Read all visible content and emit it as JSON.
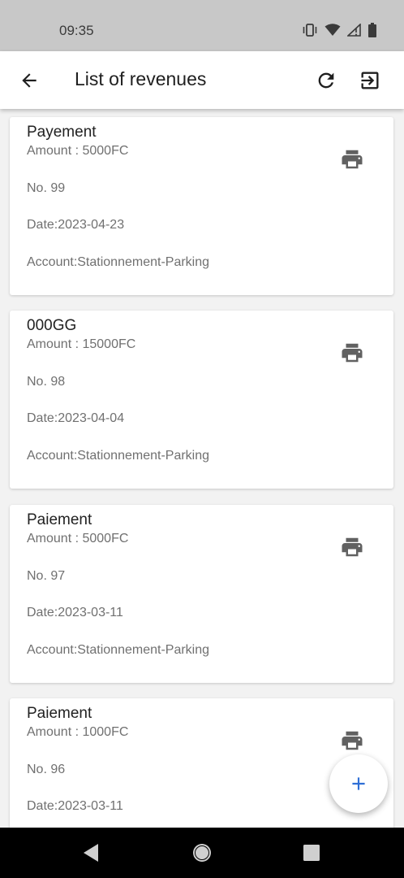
{
  "status_bar": {
    "time": "09:35",
    "icons": [
      "vibrate-icon",
      "wifi-icon",
      "signal-icon",
      "battery-icon"
    ]
  },
  "app_bar": {
    "title": "List of revenues",
    "back_icon": "arrow-back-icon",
    "refresh_icon": "refresh-icon",
    "exit_icon": "exit-to-app-icon"
  },
  "revenues": [
    {
      "title": "Payement",
      "amount": "Amount : 5000FC",
      "number": "No. 99",
      "date": "Date:2023-04-23",
      "account": "Account:Stationnement-Parking"
    },
    {
      "title": "000GG",
      "amount": "Amount : 15000FC",
      "number": "No. 98",
      "date": "Date:2023-04-04",
      "account": "Account:Stationnement-Parking"
    },
    {
      "title": "Paiement",
      "amount": "Amount : 5000FC",
      "number": "No. 97",
      "date": "Date:2023-03-11",
      "account": "Account:Stationnement-Parking"
    },
    {
      "title": "Paiement",
      "amount": "Amount : 1000FC",
      "number": "No. 96",
      "date": "Date:2023-03-11",
      "account": ""
    }
  ],
  "fab": {
    "icon": "add-icon"
  },
  "colors": {
    "status_bar_bg": "#c8c8c8",
    "icon_gray": "#616161",
    "fab_accent": "#2f6fd6",
    "nav_bar_bg": "#000000"
  }
}
